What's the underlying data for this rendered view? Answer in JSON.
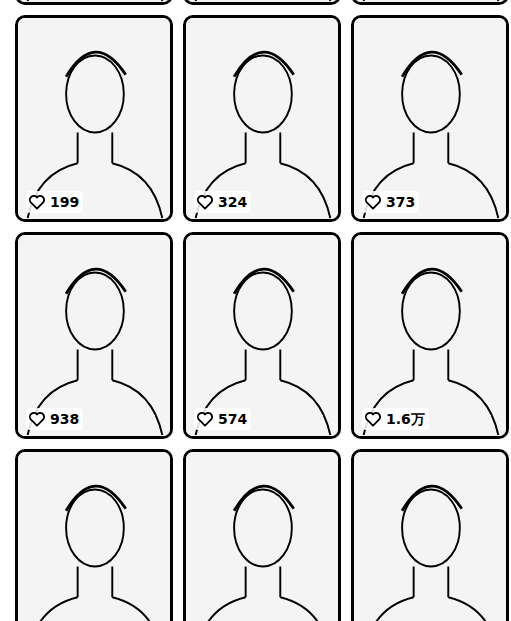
{
  "cards": [
    {
      "likes": null
    },
    {
      "likes": null
    },
    {
      "likes": null
    },
    {
      "likes": "199"
    },
    {
      "likes": "324"
    },
    {
      "likes": "373"
    },
    {
      "likes": "938"
    },
    {
      "likes": "574"
    },
    {
      "likes": "1.6万"
    },
    {
      "likes": null
    },
    {
      "likes": null
    },
    {
      "likes": null
    }
  ]
}
